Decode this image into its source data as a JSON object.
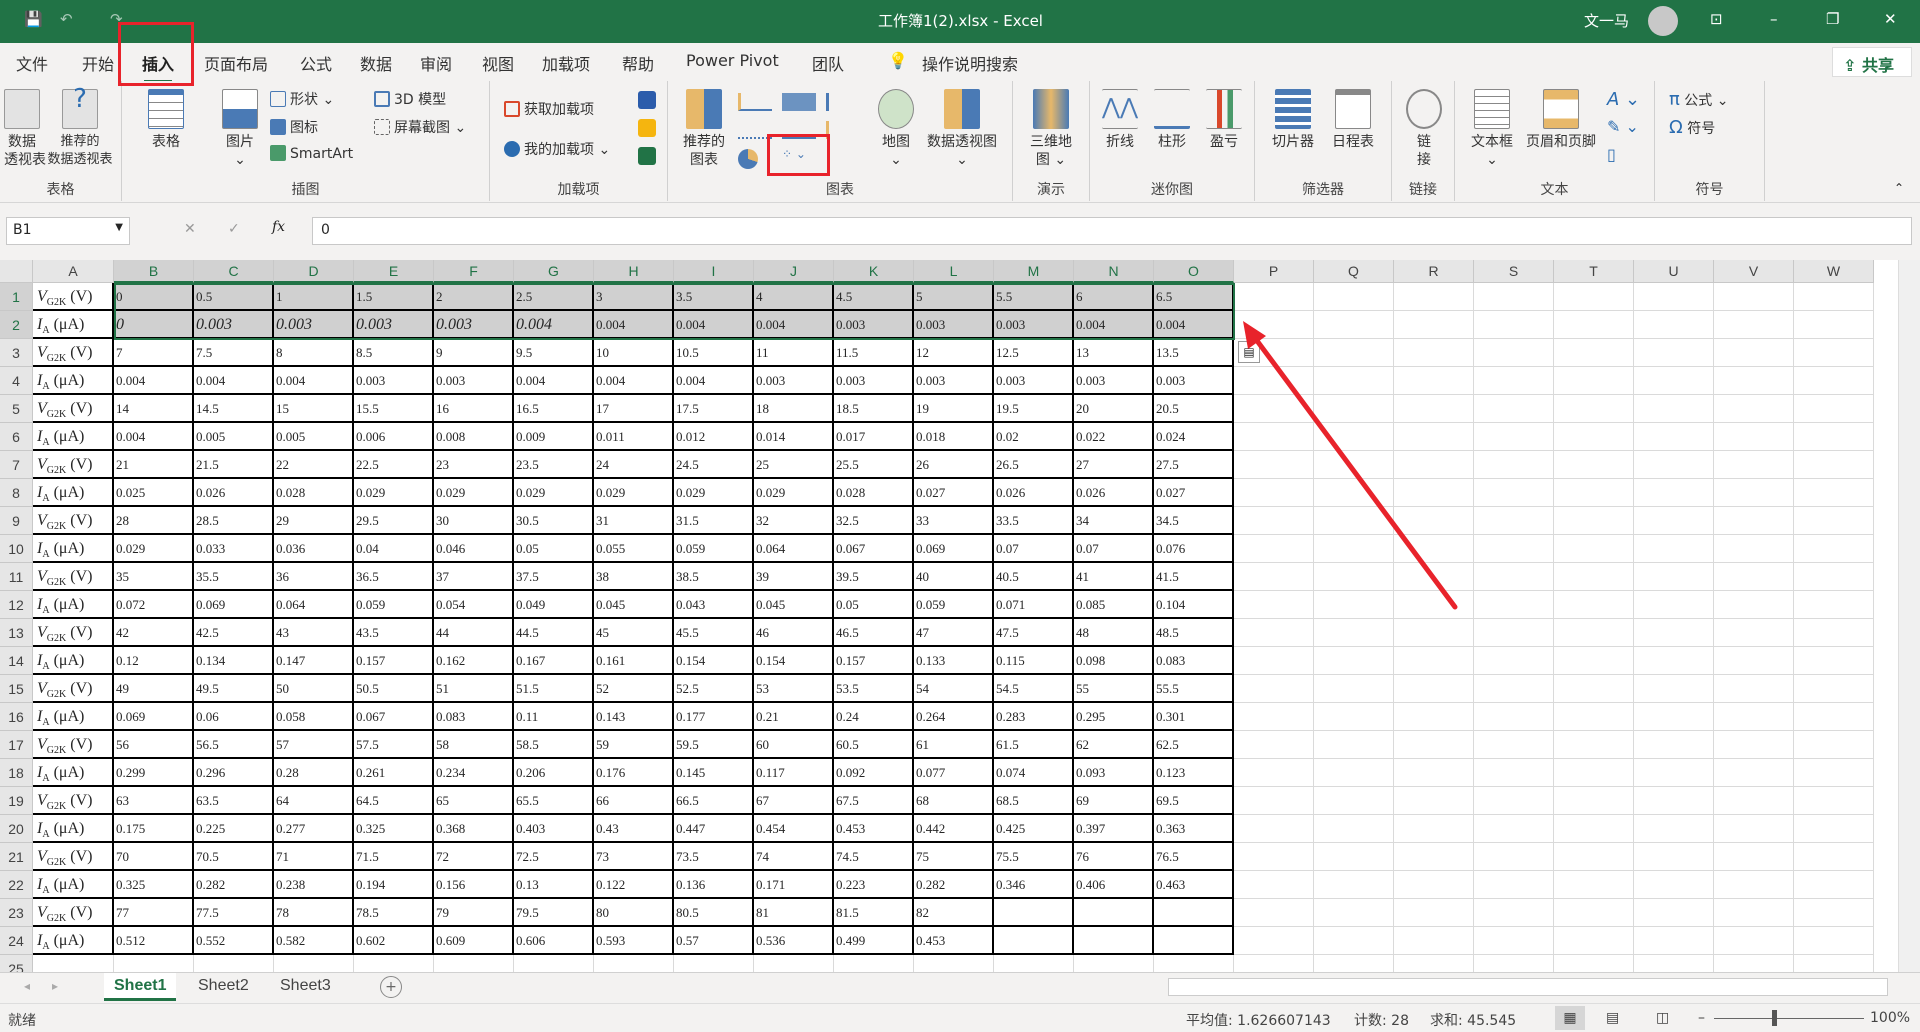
{
  "titlebar": {
    "title": "工作簿1(2).xlsx  -  Excel",
    "user": "文一马",
    "minimize": "–",
    "restore": "❐",
    "close": "✕",
    "ribbon_display": "⊡"
  },
  "quick_access": {
    "save": "💾",
    "undo": "↶",
    "redo": "↷"
  },
  "tabs": [
    "文件",
    "开始",
    "插入",
    "页面布局",
    "公式",
    "数据",
    "审阅",
    "视图",
    "加载项",
    "帮助",
    "Power Pivot",
    "团队"
  ],
  "active_tab": "插入",
  "tell_me": "操作说明搜索",
  "share": "共享",
  "ribbon": {
    "groups": {
      "tables": {
        "label": "表格",
        "pivot": "数据\n透视表",
        "rec_pivot": "推荐的\n数据透视表",
        "table": "表格"
      },
      "illustrations": {
        "label": "插图",
        "picture": "图片",
        "shapes": "形状",
        "icons": "图标",
        "smartart": "SmartArt",
        "model3d": "3D 模型",
        "screenshot": "屏幕截图"
      },
      "addins": {
        "label": "加载项",
        "get": "获取加载项",
        "my": "我的加载项"
      },
      "charts": {
        "label": "图表",
        "recommended": "推荐的\n图表",
        "maps": "地图",
        "pivotchart": "数据透视图"
      },
      "tours": {
        "label": "演示",
        "map3d": "三维地\n图"
      },
      "sparklines": {
        "label": "迷你图",
        "line": "折线",
        "column": "柱形",
        "winloss": "盈亏"
      },
      "filters": {
        "label": "筛选器",
        "slicer": "切片器",
        "timeline": "日程表"
      },
      "links": {
        "label": "链接",
        "link": "链\n接"
      },
      "text": {
        "label": "文本",
        "textbox": "文本框",
        "headerfooter": "页眉和页脚"
      },
      "symbols": {
        "label": "符号",
        "equation": "公式",
        "symbol": "符号"
      }
    }
  },
  "formula_bar": {
    "name_box": "B1",
    "cancel": "✕",
    "enter": "✓",
    "fx": "fx",
    "value": "0"
  },
  "columns": [
    "A",
    "B",
    "C",
    "D",
    "E",
    "F",
    "G",
    "H",
    "I",
    "J",
    "K",
    "L",
    "M",
    "N",
    "O",
    "P",
    "Q",
    "R",
    "S",
    "T",
    "U",
    "V",
    "W"
  ],
  "labels": {
    "V": {
      "sym": "V",
      "sub": "G2K",
      "unit": " (V)"
    },
    "I": {
      "sym": "I",
      "sub": "A",
      "unit": " (μA)"
    }
  },
  "rows": [
    {
      "type": "V",
      "values": [
        "0",
        "0.5",
        "1",
        "1.5",
        "2",
        "2.5",
        "3",
        "3.5",
        "4",
        "4.5",
        "5",
        "5.5",
        "6",
        "6.5"
      ]
    },
    {
      "type": "I",
      "values": [
        "0",
        "0.003",
        "0.003",
        "0.003",
        "0.003",
        "0.004",
        "0.004",
        "0.004",
        "0.004",
        "0.003",
        "0.003",
        "0.003",
        "0.004",
        "0.004"
      ]
    },
    {
      "type": "V",
      "values": [
        "7",
        "7.5",
        "8",
        "8.5",
        "9",
        "9.5",
        "10",
        "10.5",
        "11",
        "11.5",
        "12",
        "12.5",
        "13",
        "13.5"
      ]
    },
    {
      "type": "I",
      "values": [
        "0.004",
        "0.004",
        "0.004",
        "0.003",
        "0.003",
        "0.004",
        "0.004",
        "0.004",
        "0.003",
        "0.003",
        "0.003",
        "0.003",
        "0.003",
        "0.003"
      ]
    },
    {
      "type": "V",
      "values": [
        "14",
        "14.5",
        "15",
        "15.5",
        "16",
        "16.5",
        "17",
        "17.5",
        "18",
        "18.5",
        "19",
        "19.5",
        "20",
        "20.5"
      ]
    },
    {
      "type": "I",
      "values": [
        "0.004",
        "0.005",
        "0.005",
        "0.006",
        "0.008",
        "0.009",
        "0.011",
        "0.012",
        "0.014",
        "0.017",
        "0.018",
        "0.02",
        "0.022",
        "0.024"
      ]
    },
    {
      "type": "V",
      "values": [
        "21",
        "21.5",
        "22",
        "22.5",
        "23",
        "23.5",
        "24",
        "24.5",
        "25",
        "25.5",
        "26",
        "26.5",
        "27",
        "27.5"
      ]
    },
    {
      "type": "I",
      "values": [
        "0.025",
        "0.026",
        "0.028",
        "0.029",
        "0.029",
        "0.029",
        "0.029",
        "0.029",
        "0.029",
        "0.028",
        "0.027",
        "0.026",
        "0.026",
        "0.027"
      ]
    },
    {
      "type": "V",
      "values": [
        "28",
        "28.5",
        "29",
        "29.5",
        "30",
        "30.5",
        "31",
        "31.5",
        "32",
        "32.5",
        "33",
        "33.5",
        "34",
        "34.5"
      ]
    },
    {
      "type": "I",
      "values": [
        "0.029",
        "0.033",
        "0.036",
        "0.04",
        "0.046",
        "0.05",
        "0.055",
        "0.059",
        "0.064",
        "0.067",
        "0.069",
        "0.07",
        "0.07",
        "0.076"
      ]
    },
    {
      "type": "V",
      "values": [
        "35",
        "35.5",
        "36",
        "36.5",
        "37",
        "37.5",
        "38",
        "38.5",
        "39",
        "39.5",
        "40",
        "40.5",
        "41",
        "41.5"
      ]
    },
    {
      "type": "I",
      "values": [
        "0.072",
        "0.069",
        "0.064",
        "0.059",
        "0.054",
        "0.049",
        "0.045",
        "0.043",
        "0.045",
        "0.05",
        "0.059",
        "0.071",
        "0.085",
        "0.104"
      ]
    },
    {
      "type": "V",
      "values": [
        "42",
        "42.5",
        "43",
        "43.5",
        "44",
        "44.5",
        "45",
        "45.5",
        "46",
        "46.5",
        "47",
        "47.5",
        "48",
        "48.5"
      ]
    },
    {
      "type": "I",
      "values": [
        "0.12",
        "0.134",
        "0.147",
        "0.157",
        "0.162",
        "0.167",
        "0.161",
        "0.154",
        "0.154",
        "0.157",
        "0.133",
        "0.115",
        "0.098",
        "0.083"
      ]
    },
    {
      "type": "V",
      "values": [
        "49",
        "49.5",
        "50",
        "50.5",
        "51",
        "51.5",
        "52",
        "52.5",
        "53",
        "53.5",
        "54",
        "54.5",
        "55",
        "55.5"
      ]
    },
    {
      "type": "I",
      "values": [
        "0.069",
        "0.06",
        "0.058",
        "0.067",
        "0.083",
        "0.11",
        "0.143",
        "0.177",
        "0.21",
        "0.24",
        "0.264",
        "0.283",
        "0.295",
        "0.301"
      ]
    },
    {
      "type": "V",
      "values": [
        "56",
        "56.5",
        "57",
        "57.5",
        "58",
        "58.5",
        "59",
        "59.5",
        "60",
        "60.5",
        "61",
        "61.5",
        "62",
        "62.5"
      ]
    },
    {
      "type": "I",
      "values": [
        "0.299",
        "0.296",
        "0.28",
        "0.261",
        "0.234",
        "0.206",
        "0.176",
        "0.145",
        "0.117",
        "0.092",
        "0.077",
        "0.074",
        "0.093",
        "0.123"
      ]
    },
    {
      "type": "V",
      "values": [
        "63",
        "63.5",
        "64",
        "64.5",
        "65",
        "65.5",
        "66",
        "66.5",
        "67",
        "67.5",
        "68",
        "68.5",
        "69",
        "69.5"
      ]
    },
    {
      "type": "I",
      "values": [
        "0.175",
        "0.225",
        "0.277",
        "0.325",
        "0.368",
        "0.403",
        "0.43",
        "0.447",
        "0.454",
        "0.453",
        "0.442",
        "0.425",
        "0.397",
        "0.363"
      ]
    },
    {
      "type": "V",
      "values": [
        "70",
        "70.5",
        "71",
        "71.5",
        "72",
        "72.5",
        "73",
        "73.5",
        "74",
        "74.5",
        "75",
        "75.5",
        "76",
        "76.5"
      ]
    },
    {
      "type": "I",
      "values": [
        "0.325",
        "0.282",
        "0.238",
        "0.194",
        "0.156",
        "0.13",
        "0.122",
        "0.136",
        "0.171",
        "0.223",
        "0.282",
        "0.346",
        "0.406",
        "0.463"
      ]
    },
    {
      "type": "V",
      "values": [
        "77",
        "77.5",
        "78",
        "78.5",
        "79",
        "79.5",
        "80",
        "80.5",
        "81",
        "81.5",
        "82",
        "",
        "",
        ""
      ]
    },
    {
      "type": "I",
      "values": [
        "0.512",
        "0.552",
        "0.582",
        "0.602",
        "0.609",
        "0.606",
        "0.593",
        "0.57",
        "0.536",
        "0.499",
        "0.453",
        "",
        "",
        ""
      ]
    }
  ],
  "sheets": [
    "Sheet1",
    "Sheet2",
    "Sheet3"
  ],
  "active_sheet": "Sheet1",
  "add_sheet": "+",
  "status": {
    "ready": "就绪",
    "average": "平均值: 1.626607143",
    "count": "计数: 28",
    "sum": "求和: 45.545",
    "zoom": "100%"
  },
  "colors": {
    "accent": "#217346",
    "annotation": "#e8232b",
    "selection_fill": "#d0d0d0"
  }
}
